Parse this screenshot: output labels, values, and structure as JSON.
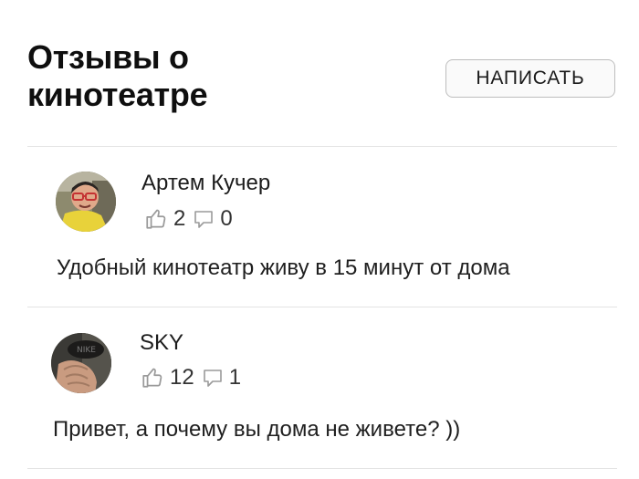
{
  "header": {
    "title": "Отзывы о кинотеатре",
    "write_button_label": "НАПИСАТЬ"
  },
  "reviews": [
    {
      "author": "Артем Кучер",
      "likes": "2",
      "comments": "0",
      "text": "Удобный кинотеатр живу в 15 минут от дома"
    },
    {
      "author": "SKY",
      "likes": "12",
      "comments": "1",
      "text": "Привет, а почему вы дома не живете? ))"
    }
  ],
  "icons": {
    "like": "thumbs-up-icon",
    "comment": "comment-icon"
  },
  "colors": {
    "text": "#111111",
    "divider": "#e4e4e4",
    "button_border": "#bdbdbd",
    "icon": "#9a9a9a"
  }
}
